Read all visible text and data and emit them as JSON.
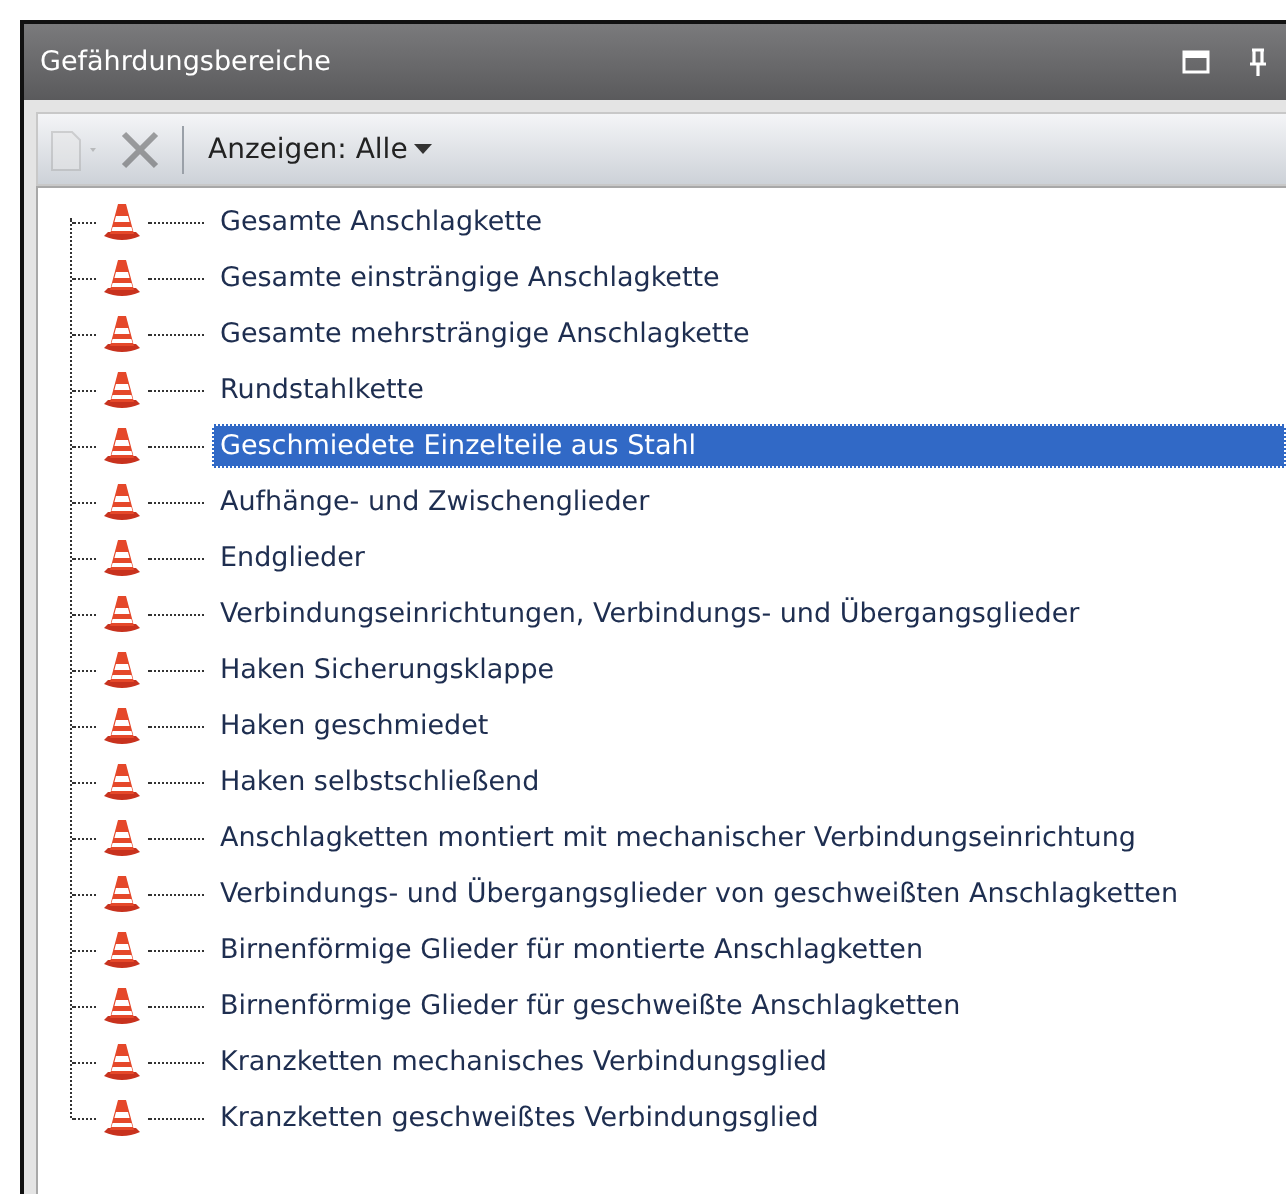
{
  "window": {
    "title": "Gefährdungsbereiche"
  },
  "toolbar": {
    "new_button": {
      "disabled": true
    },
    "delete_button": {
      "disabled": true
    },
    "filter": "Anzeigen: Alle"
  },
  "tree": {
    "items": [
      {
        "label": "Gesamte Anschlagkette",
        "selected": false
      },
      {
        "label": "Gesamte einsträngige Anschlagkette",
        "selected": false
      },
      {
        "label": "Gesamte mehrsträngige Anschlagkette",
        "selected": false
      },
      {
        "label": "Rundstahlkette",
        "selected": false
      },
      {
        "label": "Geschmiedete Einzelteile aus Stahl",
        "selected": true
      },
      {
        "label": "Aufhänge- und Zwischenglieder",
        "selected": false
      },
      {
        "label": "Endglieder",
        "selected": false
      },
      {
        "label": "Verbindungseinrichtungen, Verbindungs- und Übergangsglieder",
        "selected": false
      },
      {
        "label": "Haken Sicherungsklappe",
        "selected": false
      },
      {
        "label": "Haken geschmiedet",
        "selected": false
      },
      {
        "label": "Haken selbstschließend",
        "selected": false
      },
      {
        "label": "Anschlagketten montiert mit mechanischer Verbindungseinrichtung",
        "selected": false
      },
      {
        "label": "Verbindungs- und Übergangsglieder von geschweißten Anschlagketten",
        "selected": false
      },
      {
        "label": "Birnenförmige Glieder für montierte Anschlagketten",
        "selected": false
      },
      {
        "label": "Birnenförmige Glieder für geschweißte Anschlagketten",
        "selected": false
      },
      {
        "label": "Kranzketten mechanisches Verbindungsglied",
        "selected": false
      },
      {
        "label": "Kranzketten geschweißtes Verbindungsglied",
        "selected": false
      }
    ]
  }
}
